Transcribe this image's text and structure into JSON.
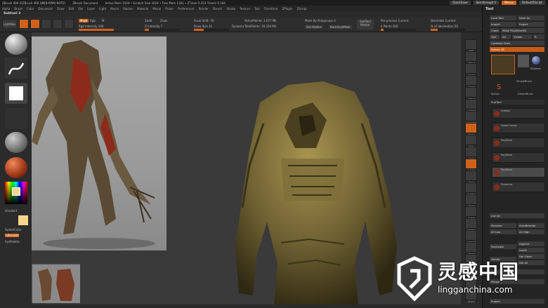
{
  "titlebar": {
    "app": "ZBrush 4R6 V(ZBrush 4R6 QM[B-RPM] NOTE)",
    "document": "ZBrush Document",
    "stats": "Active Mem 2164 • Scratch Disk 2624 • Free Mem 1181 • ZTimer 0.253 Timers 0.184",
    "quicksave": "QuickSave",
    "seethrough": "See-through 0",
    "menus": "Menus",
    "script": "DefaultZScript"
  },
  "menubar": [
    "Alpha",
    "Brush",
    "Color",
    "Document",
    "Draw",
    "Edit",
    "File",
    "Layer",
    "Light",
    "Macro",
    "Marker",
    "Material",
    "Movie",
    "Picker",
    "Preferences",
    "Render",
    "Stencil",
    "Stroke",
    "Texture",
    "Tool",
    "Transform",
    "ZPlugin",
    "ZScript"
  ],
  "subtool_label": "Subtool 3",
  "toolbar": {
    "buttons": [
      "LightBox",
      "Edit",
      "Draw",
      "Move",
      "Scale",
      "Rotate"
    ],
    "mrgb": "Mrgb",
    "rgb": "Rgb",
    "m": "M",
    "rgb_intensity": "Rgb Intensity 100",
    "zadd": "Zadd",
    "zsub": "Zsub",
    "zintensity": "Z Intensity 7",
    "focal_shift": "Focal Shift -76",
    "draw_size": "Draw Size 41",
    "dynamic": "Dynamic",
    "active_points": "ActivePoints: 1.677 Mil",
    "total_points": "TotalPoints: 19.319 Mil",
    "mask_by_polygroups": "Mask By Polygroups 0",
    "del_hidden": "Del Hidden",
    "backfacemask": "BackfaceMask",
    "subtool_master": "SubTool Master",
    "preprocess_current": "Pre-process Current",
    "k_points": "k Points 200",
    "decimate_current": "Decimate Current",
    "pct_decimation": "% of decimation 20"
  },
  "leftshelf": {
    "gradient": "Gradient",
    "switchcolor": "SwitchColor",
    "alternate": "Alternate",
    "sysPalette": "SysPalette"
  },
  "rightshelf": [
    "BPR",
    "SPix 3",
    "Scroll",
    "Zoom",
    "Actual",
    "AAHalf",
    "Dynamic",
    "Persp",
    "Floor",
    "Local",
    "L.Sym",
    "Gxyz",
    "Frame",
    "Move",
    "Scale",
    "Rotate",
    "Line Fill",
    "PolyF",
    "Transp",
    "Ghost",
    "Solo",
    "Xpose"
  ],
  "tool_panel": {
    "title": "Tool",
    "load_tool": "Load Tool",
    "save_as": "Save As",
    "import": "Import",
    "export": "Export",
    "clone": "Clone",
    "make_polymesh": "Make PolyMesh3D",
    "goz": "GoZ",
    "all": "All",
    "visible": "Visible",
    "r": "R",
    "lightbox_tools": "Lightbox›Tools",
    "spines": "Spines 48",
    "tools": [
      "Spines",
      "SimpleBrush",
      "ZSphere",
      "DreamBrush"
    ],
    "subtool_header": "SubTool",
    "subtools": [
      "Subtool",
      "LowerCorpse",
      "PolyMesh",
      "PolyMesh",
      "PolyMesh",
      "Tentacles"
    ],
    "list_all": "List All",
    "rename": "Rename",
    "autoreorder": "AutoReorder",
    "all_low": "All Low",
    "all_high": "All High",
    "duplicate": "Duplicate",
    "append": "Append",
    "insert": "Insert",
    "del_other": "Del Other",
    "delete": "Delete",
    "del_all": "Del All",
    "split": "Split",
    "merge": "Merge",
    "project": "Project"
  },
  "watermark": {
    "main": "灵感中国",
    "sub": "lingganchina.com"
  },
  "colors": {
    "accent": "#d0611a",
    "model": "#7a6a38",
    "reference_red": "#8c2a1c"
  }
}
